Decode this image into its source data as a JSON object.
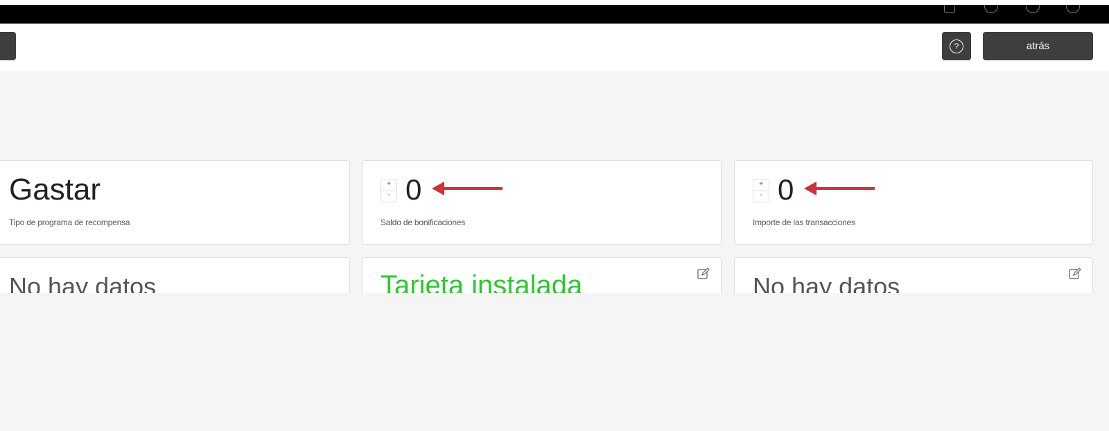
{
  "header": {
    "help_glyph": "?",
    "back_label": "atrás"
  },
  "cards_row1": [
    {
      "value": "Gastar",
      "label": "Tipo de programa de recompensa"
    },
    {
      "value": "0",
      "label": "Saldo de bonificaciones",
      "stepper_plus": "+",
      "stepper_minus": "-"
    },
    {
      "value": "0",
      "label": "Importe de las transacciones",
      "stepper_plus": "+",
      "stepper_minus": "-"
    }
  ],
  "cards_row2": [
    {
      "value": "No hay datos"
    },
    {
      "value": "Tarjeta instalada",
      "color": "#2ec72e"
    },
    {
      "value": "No hay datos"
    }
  ],
  "colors": {
    "accent_green": "#2ec72e",
    "arrow_red": "#c8353a",
    "button_dark": "#3e3e3e",
    "background": "#f5f5f6"
  },
  "icons": [
    "bell-icon",
    "circle-icon",
    "help-icon",
    "edit-icon",
    "arrow-left-annotation"
  ]
}
